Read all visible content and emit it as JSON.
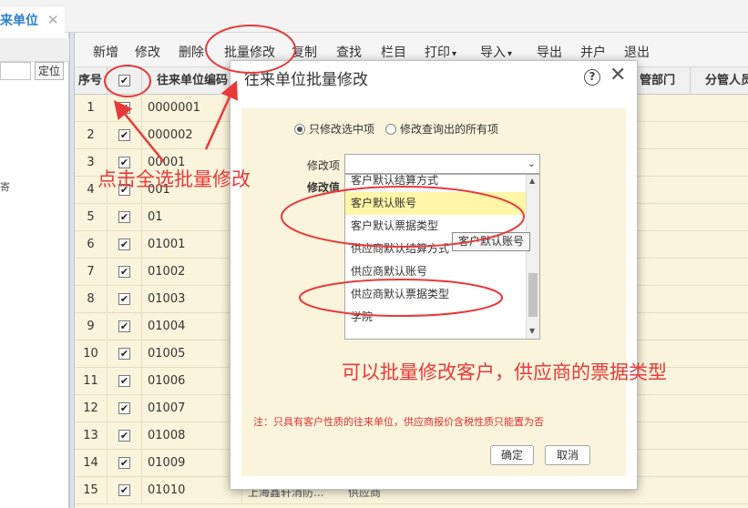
{
  "tab": {
    "label": "来单位",
    "close": "✕"
  },
  "left": {
    "locate": "定位",
    "tiny": "寄"
  },
  "toolbar": [
    {
      "id": "add",
      "label": "新增",
      "caret": false
    },
    {
      "id": "edit",
      "label": "修改",
      "caret": false
    },
    {
      "id": "delete",
      "label": "删除",
      "caret": false
    },
    {
      "id": "batch-edit",
      "label": "批量修改",
      "caret": false
    },
    {
      "id": "copy",
      "label": "复制",
      "caret": false
    },
    {
      "id": "find",
      "label": "查找",
      "caret": false
    },
    {
      "id": "columns",
      "label": "栏目",
      "caret": false
    },
    {
      "id": "print",
      "label": "打印",
      "caret": true
    },
    {
      "id": "import",
      "label": "导入",
      "caret": true
    },
    {
      "id": "export",
      "label": "导出",
      "caret": false
    },
    {
      "id": "merge",
      "label": "并户",
      "caret": false
    },
    {
      "id": "exit",
      "label": "退出",
      "caret": false
    }
  ],
  "grid": {
    "headers": {
      "index": "序号",
      "check": "✔",
      "code": "往来单位编码",
      "dept": "管部门",
      "person": "分管人员"
    },
    "rows": [
      {
        "index": "1",
        "code": "0000001"
      },
      {
        "index": "2",
        "code": "000002"
      },
      {
        "index": "3",
        "code": "00001"
      },
      {
        "index": "4",
        "code": "001"
      },
      {
        "index": "5",
        "code": "01"
      },
      {
        "index": "6",
        "code": "01001"
      },
      {
        "index": "7",
        "code": "01002"
      },
      {
        "index": "8",
        "code": "01003"
      },
      {
        "index": "9",
        "code": "01004"
      },
      {
        "index": "10",
        "code": "01005"
      },
      {
        "index": "11",
        "code": "01006"
      },
      {
        "index": "12",
        "code": "01007"
      },
      {
        "index": "13",
        "code": "01008"
      },
      {
        "index": "14",
        "code": "01009"
      },
      {
        "index": "15",
        "code": "01010"
      }
    ],
    "partial_last_row": [
      "上海鑫轩消防...",
      "供应商"
    ]
  },
  "dialog": {
    "title": "往来单位批量修改",
    "help": "?",
    "close": "✕",
    "radio_selected": "只修改选中项",
    "radio_all": "修改查询出的所有项",
    "field_item": "修改项",
    "field_value": "修改值",
    "select_caret": "⌄",
    "options": [
      {
        "label": "客户默认结算方式",
        "highlight": false
      },
      {
        "label": "客户默认账号",
        "highlight": true
      },
      {
        "label": "客户默认票据类型",
        "highlight": false
      },
      {
        "label": "供应商默认结算方式",
        "highlight": false
      },
      {
        "label": "供应商默认账号",
        "highlight": false
      },
      {
        "label": "供应商默认票据类型",
        "highlight": false
      },
      {
        "label": "学院",
        "highlight": false
      }
    ],
    "tooltip": "客户默认账号",
    "note": "注：只具有客户性质的往来单位，供应商报价含税性质只能置为否",
    "ok": "确定",
    "cancel": "取消"
  },
  "annotations": {
    "select_all": "点击全选批量修改",
    "batch_types": "可以批量修改客户，供应商的票据类型"
  },
  "colors": {
    "accent": "#2a7fd4",
    "grid_bg": "#fbf4dc",
    "annotation": "#e83a3a",
    "highlight": "#fff6a8"
  }
}
